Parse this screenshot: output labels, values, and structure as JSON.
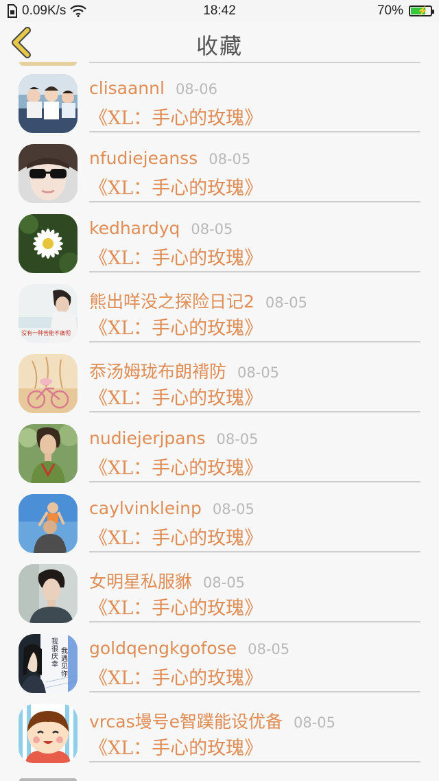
{
  "status_bar": {
    "speed": "0.09K/s",
    "time": "18:42",
    "battery": "70%",
    "battery_level": 0.7,
    "battery_color": "#35c93a"
  },
  "header": {
    "title": "收藏"
  },
  "colors": {
    "accent": "#e08c55",
    "date": "#b8b8b8",
    "back": "#e6c84a"
  },
  "items": [
    {
      "username": "clisaannl",
      "date": "08-06",
      "book": "《XL：手心的玫瑰》",
      "avatar": "avatar-students"
    },
    {
      "username": "nfudiejeanss",
      "date": "08-05",
      "book": "《XL：手心的玫瑰》",
      "avatar": "avatar-sunglasses-girl"
    },
    {
      "username": "kedhardyq",
      "date": "08-05",
      "book": "《XL：手心的玫瑰》",
      "avatar": "avatar-daisy"
    },
    {
      "username": "熊出咩没之探险日记2",
      "date": "08-05",
      "book": "《XL：手心的玫瑰》",
      "avatar": "avatar-boy-text"
    },
    {
      "username": "忝汤姆珑布朗褙防",
      "date": "08-05",
      "book": "《XL：手心的玫瑰》",
      "avatar": "avatar-bicycle"
    },
    {
      "username": "nudiejerjpans",
      "date": "08-05",
      "book": "《XL：手心的玫瑰》",
      "avatar": "avatar-woman"
    },
    {
      "username": "caylvinkleinp",
      "date": "08-05",
      "book": "《XL：手心的玫瑰》",
      "avatar": "avatar-father-child"
    },
    {
      "username": "女明星私服貅",
      "date": "08-05",
      "book": "《XL：手心的玫瑰》",
      "avatar": "avatar-young-man"
    },
    {
      "username": "goldqengkgofose",
      "date": "08-05",
      "book": "《XL：手心的玫瑰》",
      "avatar": "avatar-girl-calligraphy",
      "avatar_text": [
        "我很庆幸",
        "我遇见你"
      ]
    },
    {
      "username": "vrcas墁号e智蹼能设优备",
      "date": "08-05",
      "book": "《XL：手心的玫瑰》",
      "avatar": "avatar-cartoon-boy"
    }
  ],
  "icons": {
    "status_file": "sim-icon",
    "status_wifi": "wifi-icon",
    "battery": "battery-icon",
    "back": "back-chevron-icon"
  }
}
